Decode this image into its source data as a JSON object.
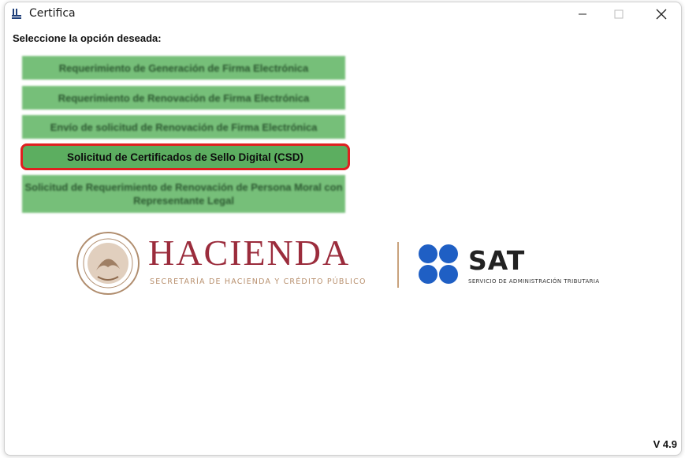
{
  "window": {
    "title": "Certifica",
    "controls": {
      "minimize": "minimize-icon",
      "maximize": "maximize-icon",
      "close": "close-icon"
    }
  },
  "prompt": "Seleccione la opción deseada:",
  "options": [
    {
      "label": "Requerimiento de Generación de Firma Electrónica",
      "highlighted": false
    },
    {
      "label": "Requerimiento de Renovación de Firma Electrónica",
      "highlighted": false
    },
    {
      "label": "Envío de solicitud de Renovación de Firma Electrónica",
      "highlighted": false
    },
    {
      "label": "Solicitud de Certificados de Sello Digital (CSD)",
      "highlighted": true
    },
    {
      "label": "Solicitud de Requerimiento de Renovación de Persona Moral con Representante Legal",
      "highlighted": false
    }
  ],
  "logos": {
    "hacienda_title": "HACIENDA",
    "hacienda_subtitle": "SECRETARÍA DE HACIENDA Y CRÉDITO PÚBLICO",
    "sat_title": "SAT",
    "sat_subtitle": "SERVICIO DE ADMINISTRACIÓN TRIBUTARIA"
  },
  "version": "V 4.9",
  "colors": {
    "button_green": "#6bba6e",
    "highlight_border": "#e02020",
    "hacienda_red": "#9b2c3c",
    "sat_blue": "#1f5fc4"
  }
}
